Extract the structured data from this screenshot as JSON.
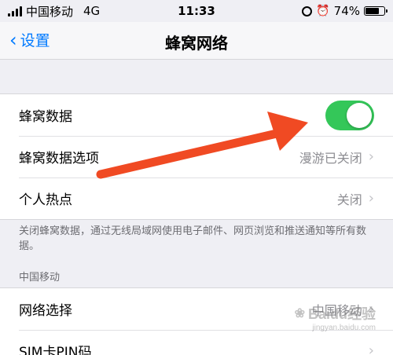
{
  "status_bar": {
    "carrier": "中国移动",
    "network": "4G",
    "time": "11:33",
    "battery": "74%",
    "battery_level": 0.74
  },
  "nav": {
    "back_label": "设置",
    "title": "蜂窝网络"
  },
  "cellular_group": {
    "cellular_data": {
      "label": "蜂窝数据",
      "enabled": true
    },
    "cellular_options": {
      "label": "蜂窝数据选项",
      "value": "漫游已关闭"
    },
    "hotspot": {
      "label": "个人热点",
      "value": "关闭"
    }
  },
  "footer_note": "关闭蜂窝数据，通过无线局域网使用电子邮件、网页浏览和推送通知等所有数据。",
  "carrier_section": {
    "header": "中国移动",
    "network_selection": {
      "label": "网络选择",
      "value": "中国移动"
    },
    "sim_pin": {
      "label": "SIM卡PIN码"
    }
  },
  "watermark": {
    "brand": "Baidu经验",
    "url": "jingyan.baidu.com"
  },
  "colors": {
    "toggle_on": "#34c759",
    "ios_blue": "#007aff",
    "arrow": "#f04a23"
  },
  "icons": {
    "back": "chevron-left-icon",
    "disclosure": "chevron-right-icon",
    "orientation_lock": "orientation-lock-icon",
    "alarm": "alarm-icon"
  }
}
